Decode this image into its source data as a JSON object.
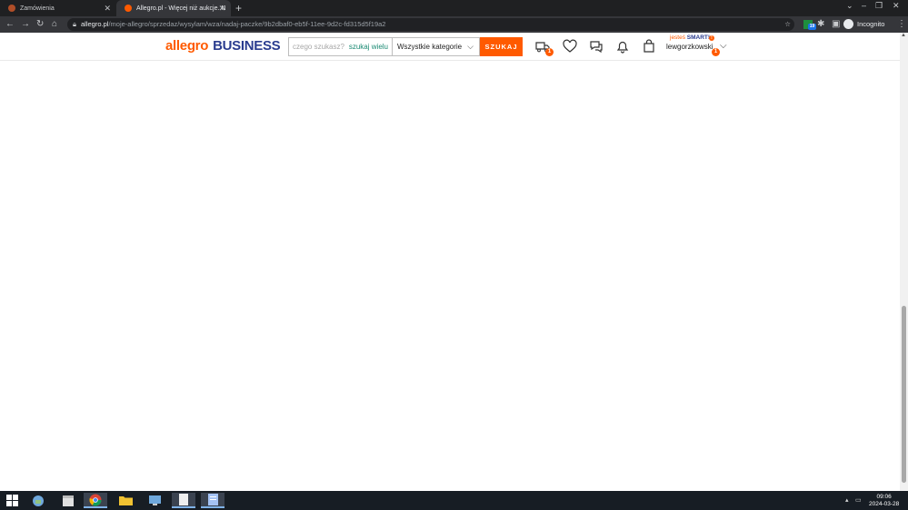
{
  "browser": {
    "tabs": [
      {
        "title": "Zamówienia",
        "close": "✕"
      },
      {
        "title": "Allegro.pl - Więcej niż aukcje. N",
        "close": "✕"
      }
    ],
    "new_tab": "+",
    "url_host": "allegro.pl",
    "url_path": "/moje-allegro/sprzedaz/wysylam/wza/nadaj-paczke/9b2dbaf0-eb5f-11ee-9d2c-fd315d5f19a2",
    "profile": "Incognito",
    "extension_badge": "19"
  },
  "header": {
    "logo_main": "allegro",
    "logo_sub": "BUSINESS",
    "search_placeholder": "czego szukasz?",
    "search_multi": "szukaj wielu",
    "category": "Wszystkie kategorie",
    "search_button": "SZUKAJ",
    "cart_badge": "1",
    "smart_prefix": "jesteś ",
    "smart_label": "SMART!",
    "smart_badge": "!",
    "username": "lewgorzkowski",
    "user_badge": "1"
  },
  "taskbar": {
    "time": "09:06",
    "date": "2024-03-28"
  },
  "colors": {
    "brand_orange": "#ff5a00",
    "business_navy": "#2a3c8f",
    "multi_search_green": "#1a8a73",
    "chrome_dark": "#35363a",
    "taskbar": "#171d24"
  }
}
